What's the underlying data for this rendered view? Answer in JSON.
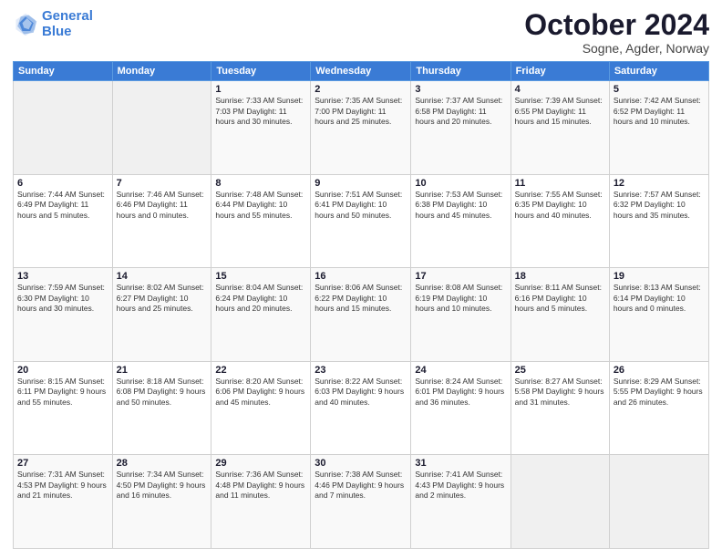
{
  "logo": {
    "line1": "General",
    "line2": "Blue"
  },
  "title": "October 2024",
  "subtitle": "Sogne, Agder, Norway",
  "days_header": [
    "Sunday",
    "Monday",
    "Tuesday",
    "Wednesday",
    "Thursday",
    "Friday",
    "Saturday"
  ],
  "weeks": [
    [
      {
        "num": "",
        "info": ""
      },
      {
        "num": "",
        "info": ""
      },
      {
        "num": "1",
        "info": "Sunrise: 7:33 AM\nSunset: 7:03 PM\nDaylight: 11 hours\nand 30 minutes."
      },
      {
        "num": "2",
        "info": "Sunrise: 7:35 AM\nSunset: 7:00 PM\nDaylight: 11 hours\nand 25 minutes."
      },
      {
        "num": "3",
        "info": "Sunrise: 7:37 AM\nSunset: 6:58 PM\nDaylight: 11 hours\nand 20 minutes."
      },
      {
        "num": "4",
        "info": "Sunrise: 7:39 AM\nSunset: 6:55 PM\nDaylight: 11 hours\nand 15 minutes."
      },
      {
        "num": "5",
        "info": "Sunrise: 7:42 AM\nSunset: 6:52 PM\nDaylight: 11 hours\nand 10 minutes."
      }
    ],
    [
      {
        "num": "6",
        "info": "Sunrise: 7:44 AM\nSunset: 6:49 PM\nDaylight: 11 hours\nand 5 minutes."
      },
      {
        "num": "7",
        "info": "Sunrise: 7:46 AM\nSunset: 6:46 PM\nDaylight: 11 hours\nand 0 minutes."
      },
      {
        "num": "8",
        "info": "Sunrise: 7:48 AM\nSunset: 6:44 PM\nDaylight: 10 hours\nand 55 minutes."
      },
      {
        "num": "9",
        "info": "Sunrise: 7:51 AM\nSunset: 6:41 PM\nDaylight: 10 hours\nand 50 minutes."
      },
      {
        "num": "10",
        "info": "Sunrise: 7:53 AM\nSunset: 6:38 PM\nDaylight: 10 hours\nand 45 minutes."
      },
      {
        "num": "11",
        "info": "Sunrise: 7:55 AM\nSunset: 6:35 PM\nDaylight: 10 hours\nand 40 minutes."
      },
      {
        "num": "12",
        "info": "Sunrise: 7:57 AM\nSunset: 6:32 PM\nDaylight: 10 hours\nand 35 minutes."
      }
    ],
    [
      {
        "num": "13",
        "info": "Sunrise: 7:59 AM\nSunset: 6:30 PM\nDaylight: 10 hours\nand 30 minutes."
      },
      {
        "num": "14",
        "info": "Sunrise: 8:02 AM\nSunset: 6:27 PM\nDaylight: 10 hours\nand 25 minutes."
      },
      {
        "num": "15",
        "info": "Sunrise: 8:04 AM\nSunset: 6:24 PM\nDaylight: 10 hours\nand 20 minutes."
      },
      {
        "num": "16",
        "info": "Sunrise: 8:06 AM\nSunset: 6:22 PM\nDaylight: 10 hours\nand 15 minutes."
      },
      {
        "num": "17",
        "info": "Sunrise: 8:08 AM\nSunset: 6:19 PM\nDaylight: 10 hours\nand 10 minutes."
      },
      {
        "num": "18",
        "info": "Sunrise: 8:11 AM\nSunset: 6:16 PM\nDaylight: 10 hours\nand 5 minutes."
      },
      {
        "num": "19",
        "info": "Sunrise: 8:13 AM\nSunset: 6:14 PM\nDaylight: 10 hours\nand 0 minutes."
      }
    ],
    [
      {
        "num": "20",
        "info": "Sunrise: 8:15 AM\nSunset: 6:11 PM\nDaylight: 9 hours\nand 55 minutes."
      },
      {
        "num": "21",
        "info": "Sunrise: 8:18 AM\nSunset: 6:08 PM\nDaylight: 9 hours\nand 50 minutes."
      },
      {
        "num": "22",
        "info": "Sunrise: 8:20 AM\nSunset: 6:06 PM\nDaylight: 9 hours\nand 45 minutes."
      },
      {
        "num": "23",
        "info": "Sunrise: 8:22 AM\nSunset: 6:03 PM\nDaylight: 9 hours\nand 40 minutes."
      },
      {
        "num": "24",
        "info": "Sunrise: 8:24 AM\nSunset: 6:01 PM\nDaylight: 9 hours\nand 36 minutes."
      },
      {
        "num": "25",
        "info": "Sunrise: 8:27 AM\nSunset: 5:58 PM\nDaylight: 9 hours\nand 31 minutes."
      },
      {
        "num": "26",
        "info": "Sunrise: 8:29 AM\nSunset: 5:55 PM\nDaylight: 9 hours\nand 26 minutes."
      }
    ],
    [
      {
        "num": "27",
        "info": "Sunrise: 7:31 AM\nSunset: 4:53 PM\nDaylight: 9 hours\nand 21 minutes."
      },
      {
        "num": "28",
        "info": "Sunrise: 7:34 AM\nSunset: 4:50 PM\nDaylight: 9 hours\nand 16 minutes."
      },
      {
        "num": "29",
        "info": "Sunrise: 7:36 AM\nSunset: 4:48 PM\nDaylight: 9 hours\nand 11 minutes."
      },
      {
        "num": "30",
        "info": "Sunrise: 7:38 AM\nSunset: 4:46 PM\nDaylight: 9 hours\nand 7 minutes."
      },
      {
        "num": "31",
        "info": "Sunrise: 7:41 AM\nSunset: 4:43 PM\nDaylight: 9 hours\nand 2 minutes."
      },
      {
        "num": "",
        "info": ""
      },
      {
        "num": "",
        "info": ""
      }
    ]
  ]
}
